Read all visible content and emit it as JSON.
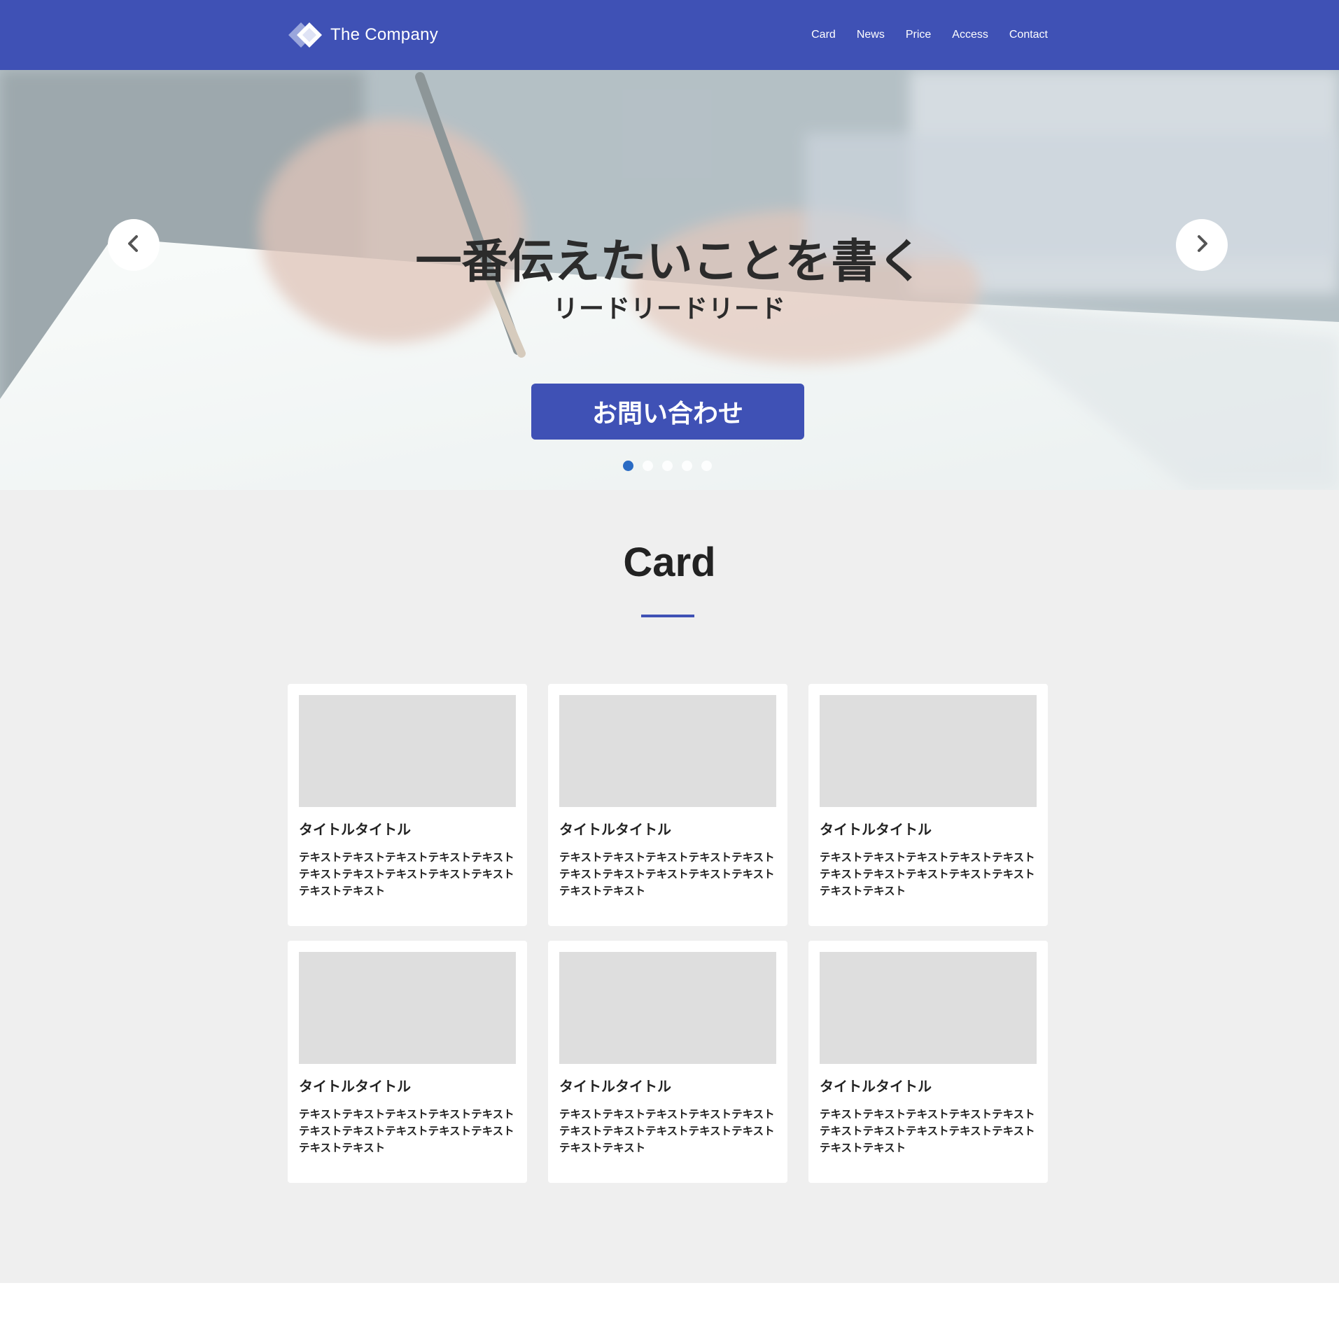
{
  "header": {
    "brand": "The Company",
    "nav": [
      "Card",
      "News",
      "Price",
      "Access",
      "Contact"
    ]
  },
  "hero": {
    "title": "一番伝えたいことを書く",
    "lead": "リードリードリード",
    "cta_label": "お問い合わせ",
    "slides_count": 5,
    "active_slide": 1,
    "prev_icon": "chevron-left-icon",
    "next_icon": "chevron-right-icon"
  },
  "card_section": {
    "title": "Card",
    "cards": [
      {
        "title": "タイトルタイトル",
        "text": "テキストテキストテキストテキストテキストテキストテキストテキストテキストテキストテキストテキスト"
      },
      {
        "title": "タイトルタイトル",
        "text": "テキストテキストテキストテキストテキストテキストテキストテキストテキストテキストテキストテキスト"
      },
      {
        "title": "タイトルタイトル",
        "text": "テキストテキストテキストテキストテキストテキストテキストテキストテキストテキストテキストテキスト"
      },
      {
        "title": "タイトルタイトル",
        "text": "テキストテキストテキストテキストテキストテキストテキストテキストテキストテキストテキストテキスト"
      },
      {
        "title": "タイトルタイトル",
        "text": "テキストテキストテキストテキストテキストテキストテキストテキストテキストテキストテキストテキスト"
      },
      {
        "title": "タイトルタイトル",
        "text": "テキストテキストテキストテキストテキストテキストテキストテキストテキストテキストテキストテキスト"
      }
    ]
  },
  "colors": {
    "primary": "#3f51b5",
    "section_bg": "#efefef",
    "thumb_placeholder": "#dedede",
    "active_dot": "#2a6bc4"
  }
}
